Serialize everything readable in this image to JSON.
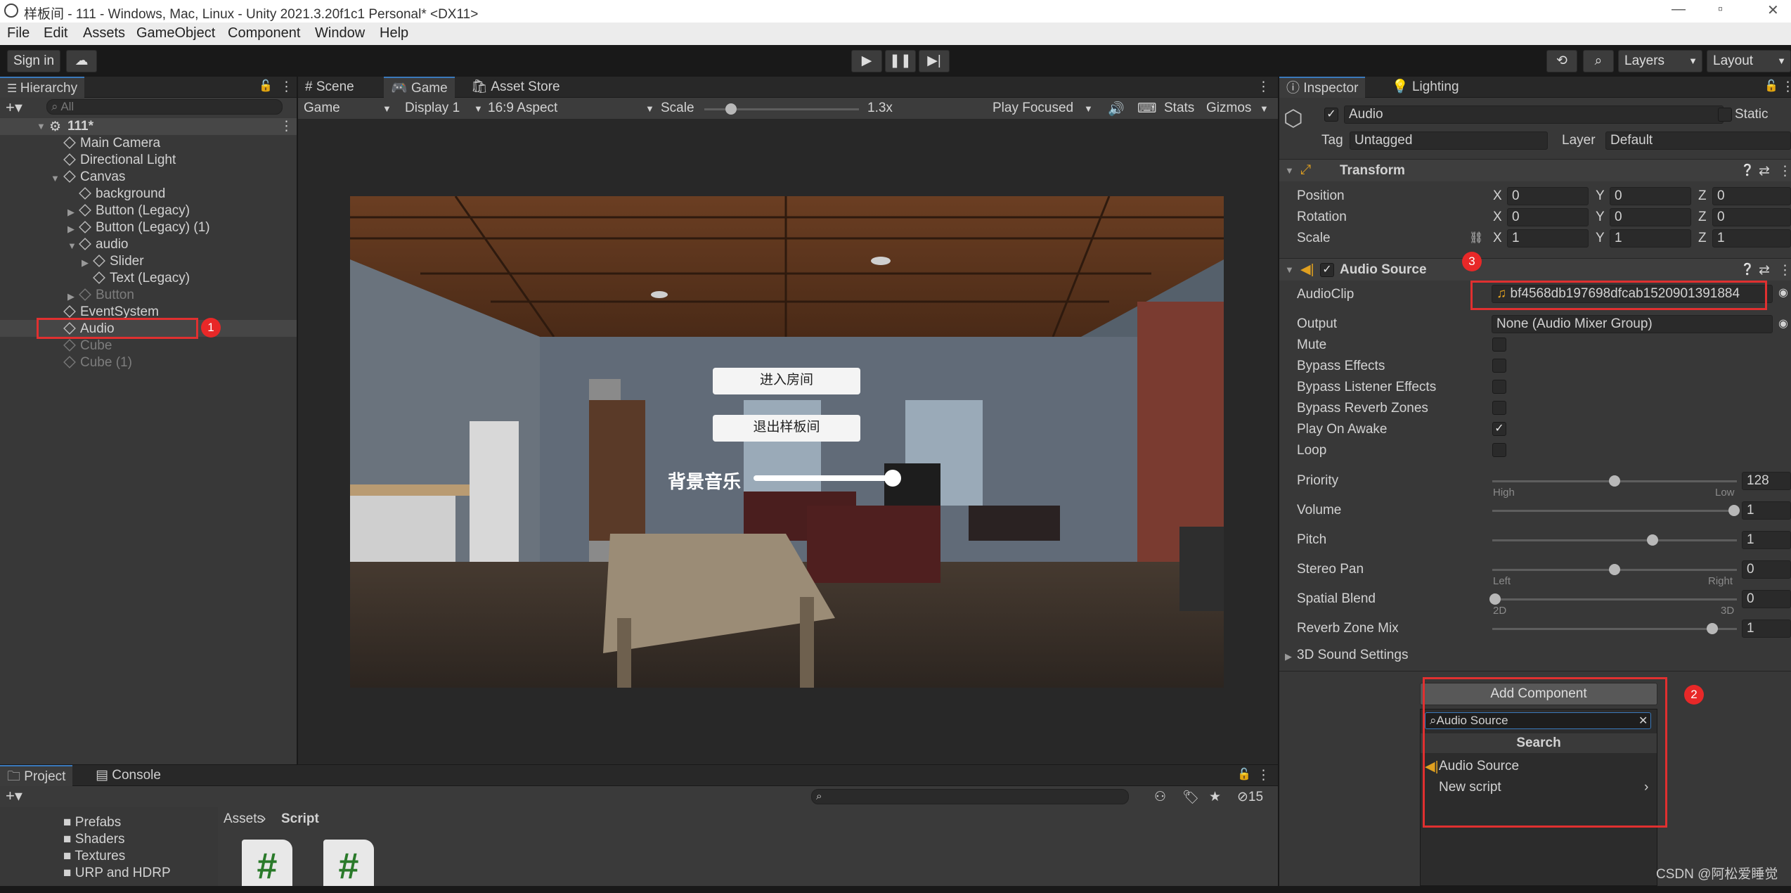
{
  "window": {
    "title": "样板间 - 111 - Windows, Mac, Linux - Unity 2021.3.20f1c1 Personal* <DX11>"
  },
  "menu": [
    "File",
    "Edit",
    "Assets",
    "GameObject",
    "Component",
    "Window",
    "Help"
  ],
  "toolbar": {
    "signin": "Sign in",
    "layers": "Layers",
    "layout": "Layout"
  },
  "hierarchy": {
    "tab": "Hierarchy",
    "search_placeholder": "All",
    "scene": "111*",
    "items": [
      {
        "label": "Main Camera",
        "dim": false
      },
      {
        "label": "Directional Light",
        "dim": false
      },
      {
        "label": "Canvas",
        "dim": false
      },
      {
        "label": "background",
        "dim": false
      },
      {
        "label": "Button (Legacy)",
        "dim": false
      },
      {
        "label": "Button (Legacy) (1)",
        "dim": false
      },
      {
        "label": "audio",
        "dim": false
      },
      {
        "label": "Slider",
        "dim": false
      },
      {
        "label": "Text (Legacy)",
        "dim": false
      },
      {
        "label": "Button",
        "dim": true
      },
      {
        "label": "EventSystem",
        "dim": false
      },
      {
        "label": "Audio",
        "dim": false
      },
      {
        "label": "Cube",
        "dim": true
      },
      {
        "label": "Cube (1)",
        "dim": true
      }
    ]
  },
  "center": {
    "tabs": [
      "Scene",
      "Game",
      "Asset Store"
    ],
    "game_bar": {
      "mode": "Game",
      "display": "Display 1",
      "aspect": "16:9 Aspect",
      "scale_label": "Scale",
      "scale_value": "1.3x",
      "play_focused": "Play Focused",
      "stats": "Stats",
      "gizmos": "Gizmos"
    },
    "game_ui": {
      "enter": "进入房间",
      "exit": "退出样板间",
      "bgm": "背景音乐"
    }
  },
  "inspector": {
    "tabs": [
      "Inspector",
      "Lighting"
    ],
    "name": "Audio",
    "static": "Static",
    "tag_label": "Tag",
    "tag": "Untagged",
    "layer_label": "Layer",
    "layer": "Default",
    "transform": {
      "title": "Transform",
      "rows": [
        {
          "label": "Position",
          "x": "0",
          "y": "0",
          "z": "0"
        },
        {
          "label": "Rotation",
          "x": "0",
          "y": "0",
          "z": "0"
        },
        {
          "label": "Scale",
          "x": "1",
          "y": "1",
          "z": "1"
        }
      ]
    },
    "audio_source": {
      "title": "Audio Source",
      "clip_label": "AudioClip",
      "clip": "bf4568db197698dfcab1520901391884",
      "output_label": "Output",
      "output": "None (Audio Mixer Group)",
      "toggles": [
        {
          "label": "Mute",
          "checked": false
        },
        {
          "label": "Bypass Effects",
          "checked": false
        },
        {
          "label": "Bypass Listener Effects",
          "checked": false
        },
        {
          "label": "Bypass Reverb Zones",
          "checked": false
        },
        {
          "label": "Play On Awake",
          "checked": true
        },
        {
          "label": "Loop",
          "checked": false
        }
      ],
      "sliders": [
        {
          "label": "Priority",
          "value": "128",
          "pos": 0.5,
          "left": "High",
          "right": "Low"
        },
        {
          "label": "Volume",
          "value": "1",
          "pos": 1.0,
          "left": "",
          "right": ""
        },
        {
          "label": "Pitch",
          "value": "1",
          "pos": 0.66,
          "left": "",
          "right": ""
        },
        {
          "label": "Stereo Pan",
          "value": "0",
          "pos": 0.5,
          "left": "Left",
          "right": "Right"
        },
        {
          "label": "Spatial Blend",
          "value": "0",
          "pos": 0.0,
          "left": "2D",
          "right": "3D"
        },
        {
          "label": "Reverb Zone Mix",
          "value": "1",
          "pos": 0.91,
          "left": "",
          "right": ""
        }
      ],
      "sound3d": "3D Sound Settings"
    },
    "add_component": "Add Component",
    "search_value": "Audio Source",
    "search_title": "Search",
    "results": [
      "Audio Source",
      "New script"
    ]
  },
  "bottom": {
    "tabs": [
      "Project",
      "Console"
    ],
    "folders": [
      "Prefabs",
      "Shaders",
      "Textures",
      "URP and HDRP"
    ],
    "breadcrumb": [
      "Assets",
      "Script"
    ],
    "hidden_count": "15"
  },
  "badges": [
    "1",
    "2",
    "3"
  ],
  "watermark": "CSDN @阿松爱睡觉"
}
